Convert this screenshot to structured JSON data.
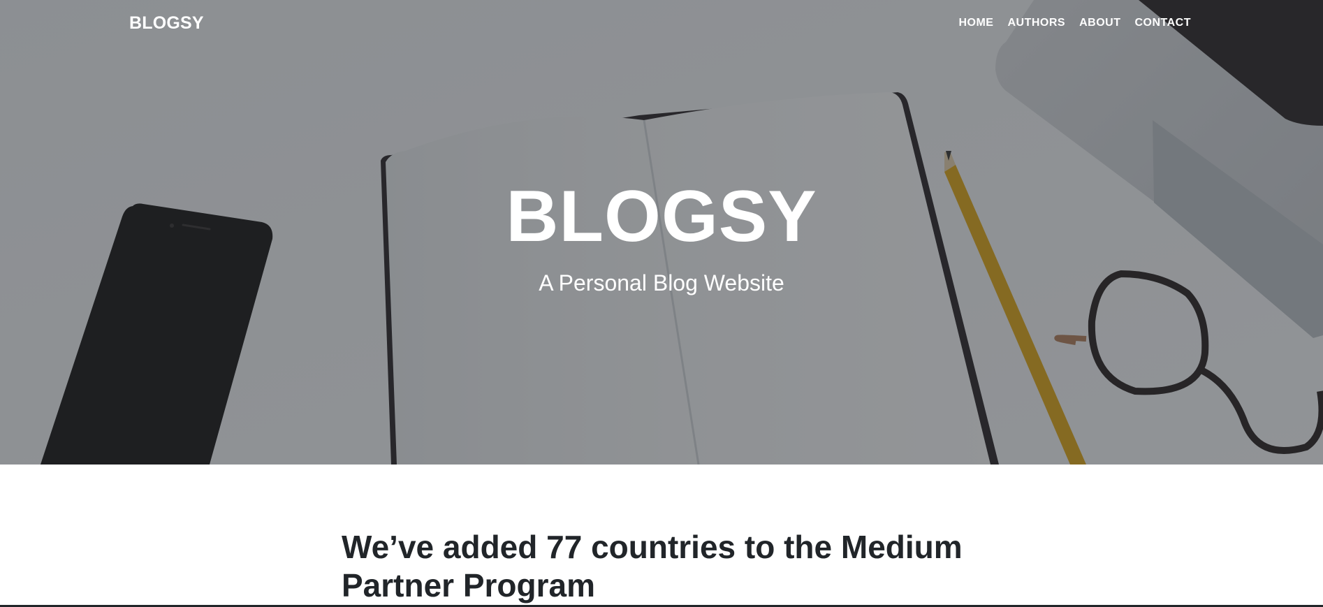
{
  "navbar": {
    "brand": "BLOGSY",
    "links": [
      "HOME",
      "AUTHORS",
      "ABOUT",
      "CONTACT"
    ]
  },
  "hero": {
    "title": "BLOGSY",
    "subtitle": "A Personal Blog Website"
  },
  "posts": [
    {
      "title": "We’ve added 77 countries to the Medium Partner Program"
    }
  ],
  "colors": {
    "overlay": "#212529",
    "text_dark": "#212529",
    "text_light": "#ffffff",
    "background": "#ffffff"
  }
}
